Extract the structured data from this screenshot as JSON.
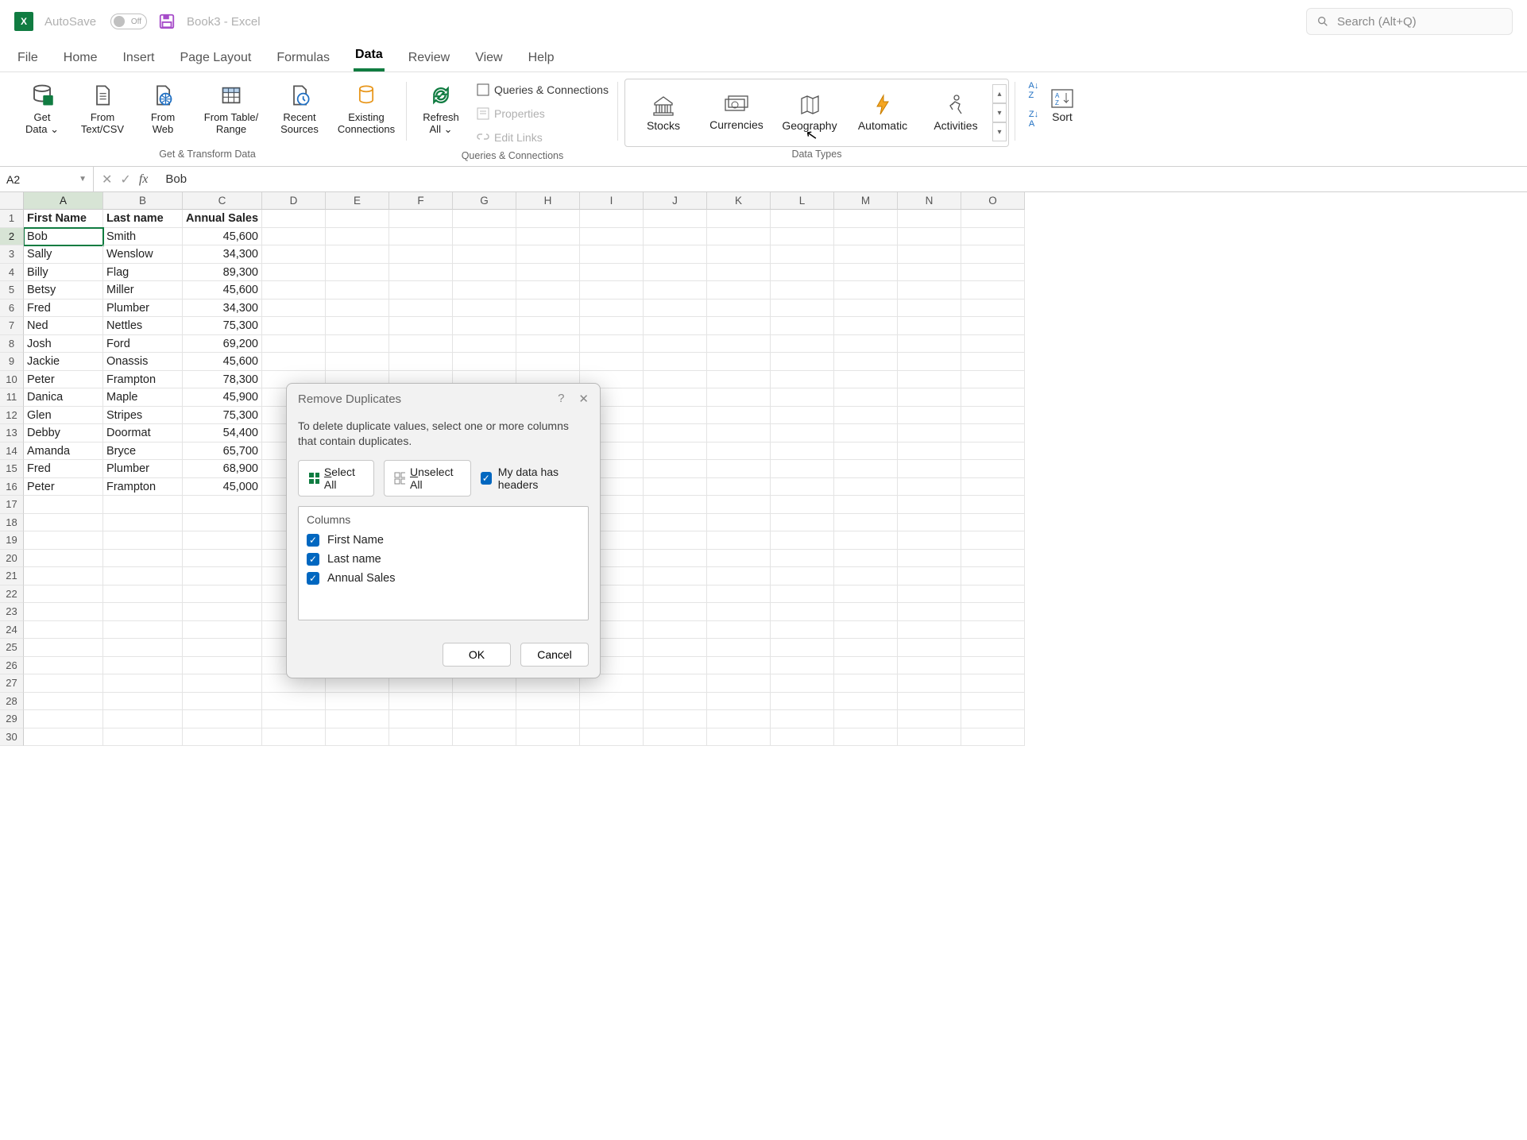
{
  "title": {
    "autosave": "AutoSave",
    "autosave_state": "Off",
    "doc": "Book3  -  Excel"
  },
  "search": {
    "placeholder": "Search (Alt+Q)"
  },
  "tabs": {
    "file": "File",
    "home": "Home",
    "insert": "Insert",
    "page_layout": "Page Layout",
    "formulas": "Formulas",
    "data": "Data",
    "review": "Review",
    "view": "View",
    "help": "Help"
  },
  "ribbon": {
    "get_data": "Get\nData ⌄",
    "from_csv": "From\nText/CSV",
    "from_web": "From\nWeb",
    "from_table": "From Table/\nRange",
    "recent": "Recent\nSources",
    "existing": "Existing\nConnections",
    "group_get": "Get & Transform Data",
    "refresh": "Refresh\nAll ⌄",
    "q_conn": "Queries & Connections",
    "properties": "Properties",
    "edit_links": "Edit Links",
    "group_qc": "Queries & Connections",
    "stocks": "Stocks",
    "currencies": "Currencies",
    "geography": "Geography",
    "automatic": "Automatic",
    "activities": "Activities",
    "group_dt": "Data Types",
    "sort": "Sort"
  },
  "namebox": "A2",
  "formula": "Bob",
  "columns": [
    "A",
    "B",
    "C",
    "D",
    "E",
    "F",
    "G",
    "H",
    "I",
    "J",
    "K",
    "L",
    "M",
    "N",
    "O"
  ],
  "headers": {
    "a": "First Name",
    "b": "Last name",
    "c": "Annual Sales"
  },
  "rows": [
    {
      "a": "Bob",
      "b": "Smith",
      "c": "45,600"
    },
    {
      "a": "Sally",
      "b": "Wenslow",
      "c": "34,300"
    },
    {
      "a": "Billy",
      "b": "Flag",
      "c": "89,300"
    },
    {
      "a": "Betsy",
      "b": "Miller",
      "c": "45,600"
    },
    {
      "a": "Fred",
      "b": "Plumber",
      "c": "34,300"
    },
    {
      "a": "Ned",
      "b": "Nettles",
      "c": "75,300"
    },
    {
      "a": "Josh",
      "b": "Ford",
      "c": "69,200"
    },
    {
      "a": "Jackie",
      "b": "Onassis",
      "c": "45,600"
    },
    {
      "a": "Peter",
      "b": "Frampton",
      "c": "78,300"
    },
    {
      "a": "Danica",
      "b": "Maple",
      "c": "45,900"
    },
    {
      "a": "Glen",
      "b": "Stripes",
      "c": "75,300"
    },
    {
      "a": "Debby",
      "b": "Doormat",
      "c": "54,400"
    },
    {
      "a": "Amanda",
      "b": "Bryce",
      "c": "65,700"
    },
    {
      "a": "Fred",
      "b": "Plumber",
      "c": "68,900"
    },
    {
      "a": "Peter",
      "b": "Frampton",
      "c": "45,000"
    }
  ],
  "dialog": {
    "title": "Remove Duplicates",
    "msg": "To delete duplicate values, select one or more columns that contain duplicates.",
    "select_all": "Select All",
    "unselect_all": "Unselect All",
    "headers_label": "My data has headers",
    "cols_label": "Columns",
    "col1": "First Name",
    "col2": "Last name",
    "col3": "Annual Sales",
    "ok": "OK",
    "cancel": "Cancel"
  }
}
